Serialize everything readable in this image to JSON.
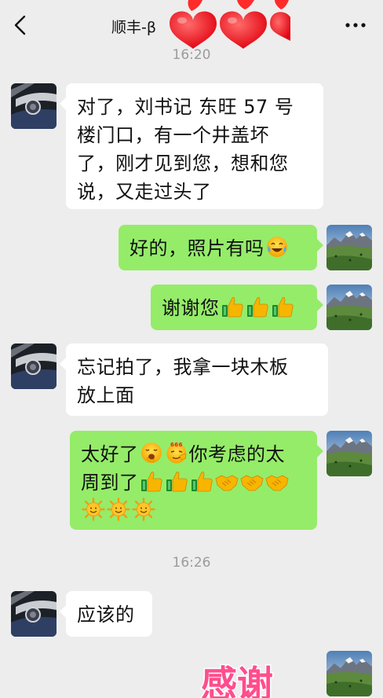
{
  "header": {
    "title": "顺丰-β"
  },
  "timestamps": {
    "t1": "16:20",
    "t2": "16:26"
  },
  "messages": {
    "m1": {
      "line1": "对了，刘书记 东旺 57 号",
      "line2": "楼门口，有一个井盖坏",
      "line3": "了，刚才见到您，想和您",
      "line4": "说，又走过头了"
    },
    "m2": {
      "text": "好的，照片有吗"
    },
    "m3": {
      "text": "谢谢您"
    },
    "m4": {
      "line1": "忘记拍了，我拿一块木板",
      "line2": "放上面"
    },
    "m5": {
      "line1_a": "太好了",
      "line1_b": "你考虑的太",
      "line2": "周到了"
    },
    "m6": {
      "text": "应该的"
    }
  },
  "sticker": {
    "text": "感谢"
  },
  "colors": {
    "outgoing": "#95ec69",
    "incoming": "#ffffff",
    "background": "#ededed"
  },
  "icons": [
    "back-icon",
    "more-icon",
    "laughing-crying-emoji",
    "thumbs-up-emoji",
    "handshake-emoji",
    "sun-emoji",
    "yawn-emoji",
    "666-emoji"
  ]
}
